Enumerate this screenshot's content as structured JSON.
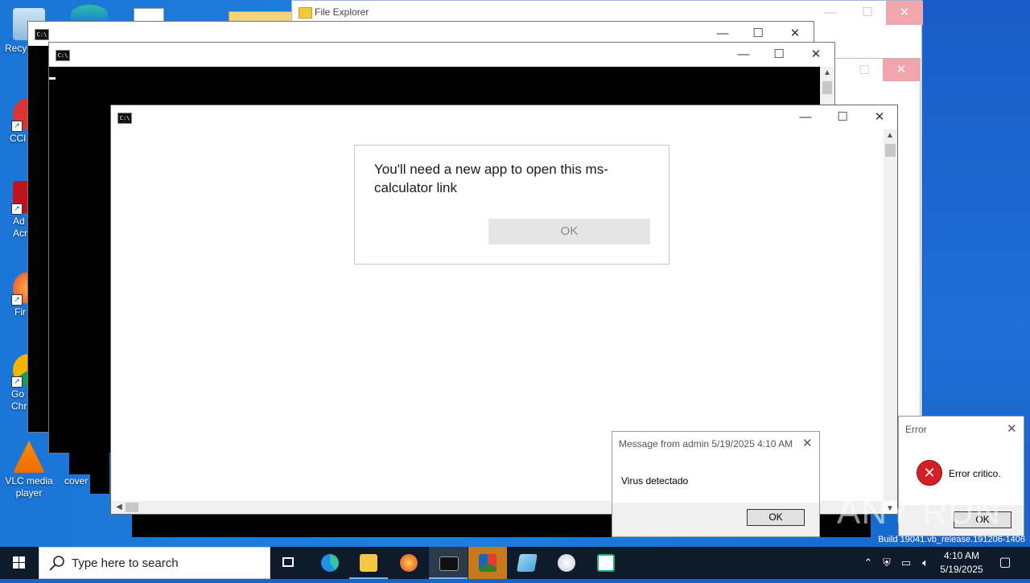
{
  "desktop": {
    "icons": [
      {
        "label": "Recy"
      },
      {
        "label": "CCl"
      },
      {
        "label": "Ad Acr"
      },
      {
        "label": "Fir"
      },
      {
        "label": "Go Chr"
      },
      {
        "label": "VLC media player"
      },
      {
        "label": "cover"
      }
    ]
  },
  "file_explorer": {
    "title": "File Explorer"
  },
  "main_window": {
    "dialog": {
      "message": "You'll need a new app to open this ms-calculator link",
      "ok_label": "OK"
    }
  },
  "message_box": {
    "title": "Message from admin 5/19/2025 4:10 AM",
    "body": "Virus detectado",
    "ok_label": "OK"
  },
  "error_box": {
    "title": "Error",
    "body": "Error critico.",
    "ok_label": "OK"
  },
  "watermark": "ANY RUN",
  "build_text": "Build 19041.vb_release.191206-1406",
  "taskbar": {
    "search_placeholder": "Type here to search",
    "clock_time": "4:10 AM",
    "clock_date": "5/19/2025"
  },
  "colors": {
    "desktop": "#1b75d6",
    "taskbar": "#0f1b2a",
    "error_red": "#d41f26"
  }
}
